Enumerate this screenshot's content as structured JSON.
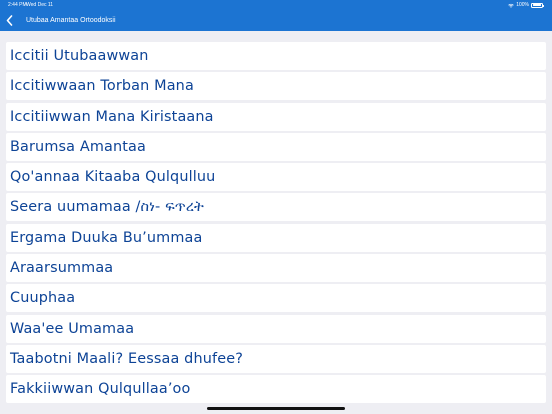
{
  "status_bar": {
    "time": "2:44 PM",
    "date": "Wed Dec 11",
    "battery": "100%",
    "wifi_icon": "wifi-icon",
    "battery_icon": "battery-icon"
  },
  "nav": {
    "back_icon": "chevron-left-icon",
    "title": "Utubaa Amantaa Ortoodoksii",
    "bar_color": "#1c74d2"
  },
  "list": {
    "text_color": "#0d4396",
    "items": [
      {
        "label": "Iccitii Utubaawwan"
      },
      {
        "label": "Iccitiwwaan Torban Mana"
      },
      {
        "label": "Iccitiiwwan Mana Kiristaana"
      },
      {
        "label": "Barumsa Amantaa"
      },
      {
        "label": "Qo'annaa Kitaaba Qulqulluu"
      },
      {
        "label": "Seera uumamaa /ስነ- ፍጥረት"
      },
      {
        "label": "Ergama Duuka Bu’ummaa"
      },
      {
        "label": "Araarsummaa"
      },
      {
        "label": "Cuuphaa"
      },
      {
        "label": "Waa'ee Umamaa"
      },
      {
        "label": "Taabotni Maali? Eessaa dhufee?"
      },
      {
        "label": "Fakkiiwwan Qulqullaa’oo"
      }
    ]
  }
}
